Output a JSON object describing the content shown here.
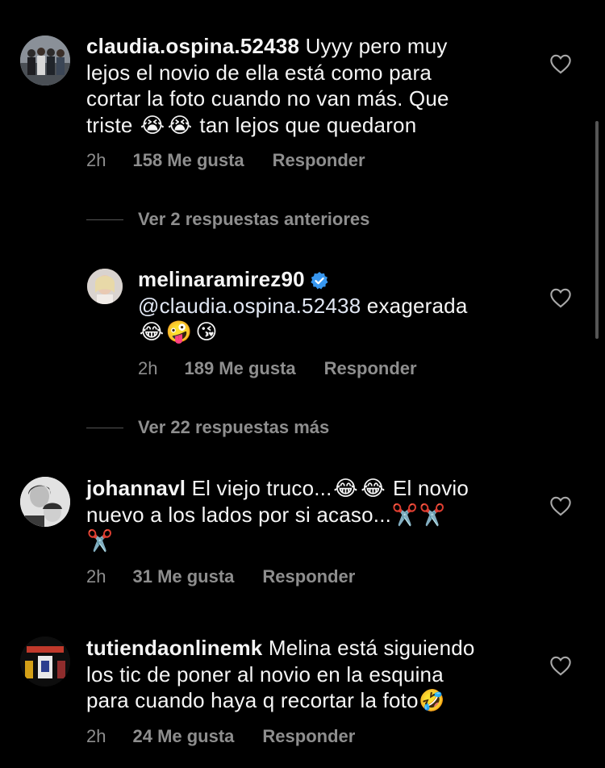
{
  "comments": [
    {
      "username": "claudia.ospina.52438",
      "lines": [
        "Uyyy pero muy",
        "lejos el novio de ella está como para",
        "cortar la foto cuando no van más. Que",
        "triste"
      ],
      "emojis": [
        "😭",
        "😭"
      ],
      "tail": "tan lejos que quedaron",
      "time": "2h",
      "likes": "158 Me gusta",
      "reply": "Responder"
    },
    {
      "view_more": "Ver 2 respuestas anteriores"
    },
    {
      "username": "melinaramirez90",
      "mention": "@claudia.ospina.52438",
      "text": "exagerada",
      "emojis": [
        "😂",
        "🤪",
        "😘"
      ],
      "time": "2h",
      "likes": "189 Me gusta",
      "reply": "Responder"
    },
    {
      "view_more": "Ver 22 respuestas más"
    },
    {
      "username": "johannavl",
      "line1_a": "El viejo truco...",
      "emojis": [
        "😂",
        "😂",
        "✂️",
        "✂️",
        "✂️"
      ],
      "line1_b": "El novio",
      "line2": "nuevo a  los lados por si acaso...",
      "time": "2h",
      "likes": "31 Me gusta",
      "reply": "Responder"
    },
    {
      "username": "tutiendaonlinemk",
      "line1": "Melina está siguiendo",
      "line2": "los tic de poner al novio en la esquina",
      "line3": "para cuando haya q recortar la foto",
      "emojis": [
        "🤣"
      ],
      "time": "2h",
      "likes": "24 Me gusta",
      "reply": "Responder"
    }
  ],
  "colors": {
    "background": "#000000",
    "text": "#f5f5f5",
    "muted": "#8e8e8e",
    "verified": "#3897f0"
  },
  "icons": [
    "heart-outline-icon",
    "verified-badge-icon"
  ]
}
